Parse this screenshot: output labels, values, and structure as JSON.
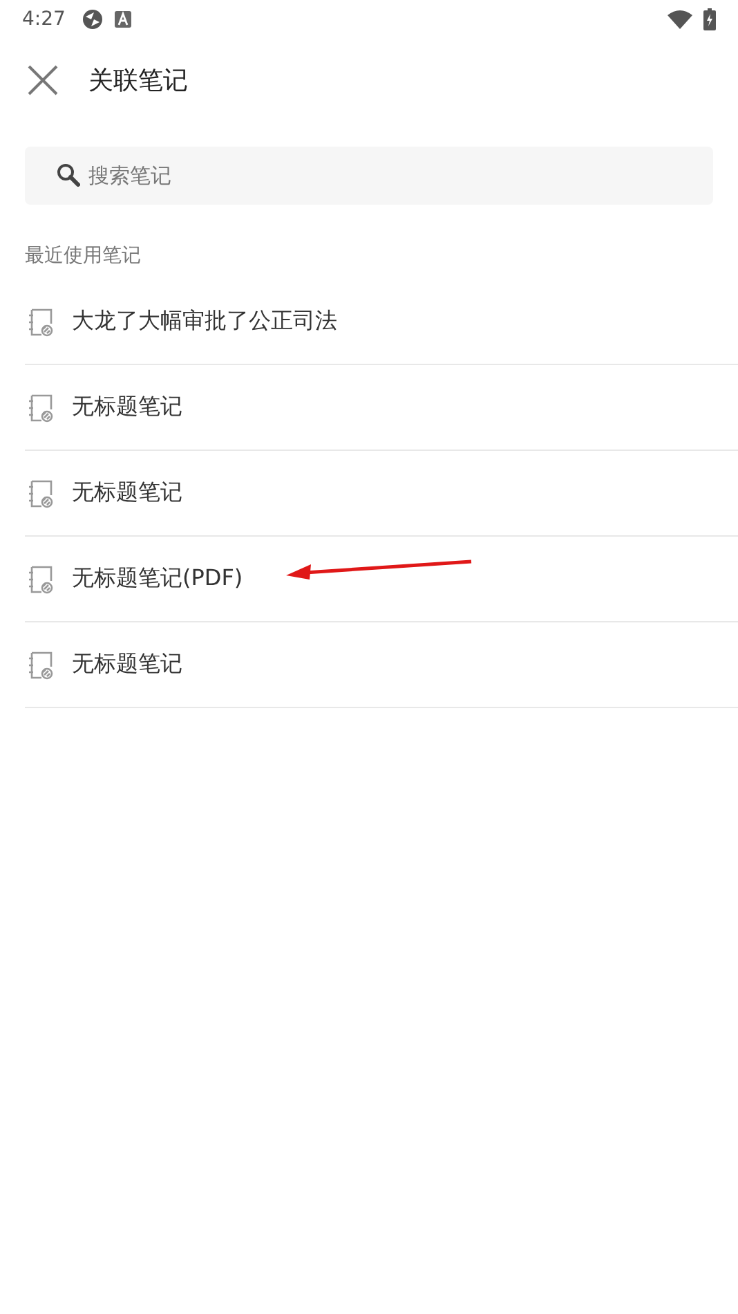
{
  "status_bar": {
    "time": "4:27"
  },
  "header": {
    "title": "关联笔记"
  },
  "search": {
    "placeholder": "搜索笔记"
  },
  "section": {
    "label": "最近使用笔记"
  },
  "notes": [
    {
      "title": "大龙了大幅审批了公正司法"
    },
    {
      "title": "无标题笔记"
    },
    {
      "title": "无标题笔记"
    },
    {
      "title": "无标题笔记(PDF)"
    },
    {
      "title": "无标题笔记"
    }
  ]
}
